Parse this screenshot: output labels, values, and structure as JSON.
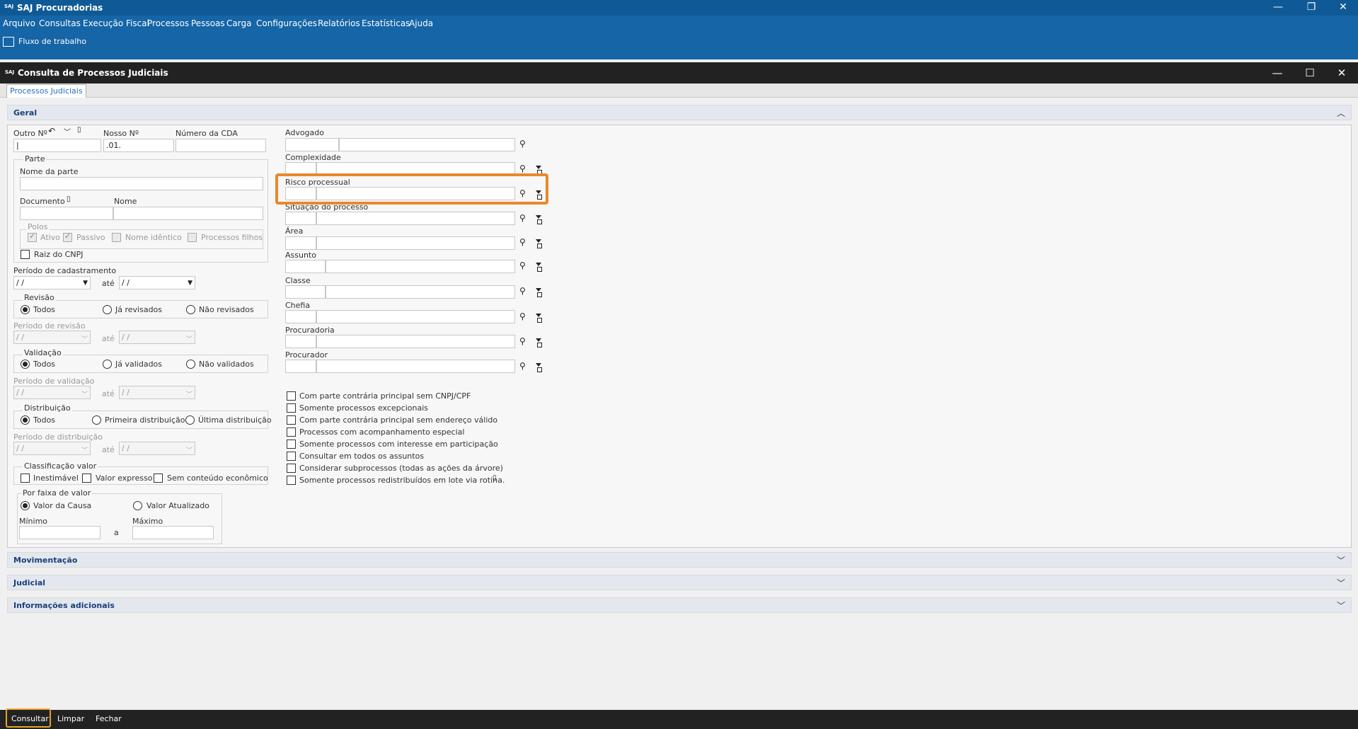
{
  "app": {
    "logo": "SAJ",
    "title": "SAJ Procuradorias"
  },
  "menu": [
    "Arquivo",
    "Consultas",
    "Execução Fiscal",
    "Processos",
    "Pessoas",
    "Carga",
    "Configurações",
    "Relatórios",
    "Estatísticas",
    "Ajuda"
  ],
  "workflow_label": "Fluxo de trabalho",
  "dialog": {
    "logo": "SAJ",
    "title": "Consulta de Processos Judiciais",
    "tab": "Processos Judiciais"
  },
  "sections": {
    "geral": "Geral",
    "mov": "Movimentação",
    "jud": "Judicial",
    "info": "Informações adicionais"
  },
  "left": {
    "outro": "Outro Nº",
    "nosso": "Nosso Nº",
    "nosso_val": ".01.",
    "cda": "Número da CDA",
    "parte": "Parte",
    "nome_parte": "Nome da parte",
    "documento": "Documento",
    "nome": "Nome",
    "polos": "Polos",
    "ativo": "Ativo",
    "passivo": "Passivo",
    "nome_identico": "Nome idêntico",
    "proc_filhos": "Processos filhos",
    "raiz": "Raiz do CNPJ",
    "per_cad": "Período de cadastramento",
    "date_ph": "/ /",
    "ate": "até",
    "revisao": "Revisão",
    "todos": "Todos",
    "ja_rev": "Já revisados",
    "nao_rev": "Não revisados",
    "per_rev": "Período de revisão",
    "validacao": "Validação",
    "ja_val": "Já validados",
    "nao_val": "Não validados",
    "per_val": "Período de validação",
    "distribuicao": "Distribuição",
    "primeira": "Primeira distribuição",
    "ultima": "Última distribuição",
    "per_dist": "Período de distribuição",
    "class_valor": "Classificação valor",
    "inestimavel": "Inestimável",
    "valor_expresso": "Valor expresso",
    "sem_conteudo": "Sem conteúdo econômico",
    "faixa": "Por faixa de valor",
    "valor_causa": "Valor da Causa",
    "valor_atual": "Valor Atualizado",
    "minimo": "Mínimo",
    "maximo": "Máximo",
    "a": "a"
  },
  "mid": {
    "advogado": "Advogado",
    "complexidade": "Complexidade",
    "risco": "Risco processual",
    "situacao": "Situação do processo",
    "area": "Área",
    "assunto": "Assunto",
    "classe": "Classe",
    "chefia": "Chefia",
    "procuradoria": "Procuradoria",
    "procurador": "Procurador"
  },
  "checks": [
    "Com parte contrária principal sem CNPJ/CPF",
    "Somente processos excepcionais",
    "Com parte contrária principal sem endereço válido",
    "Processos com acompanhamento especial",
    "Somente processos com interesse em participação",
    "Consultar em todos os assuntos",
    "Considerar subprocessos (todas as ações da árvore)",
    "Somente processos redistribuídos em lote via rotina."
  ],
  "buttons": {
    "consultar": "Consultar",
    "limpar": "Limpar",
    "fechar": "Fechar"
  }
}
